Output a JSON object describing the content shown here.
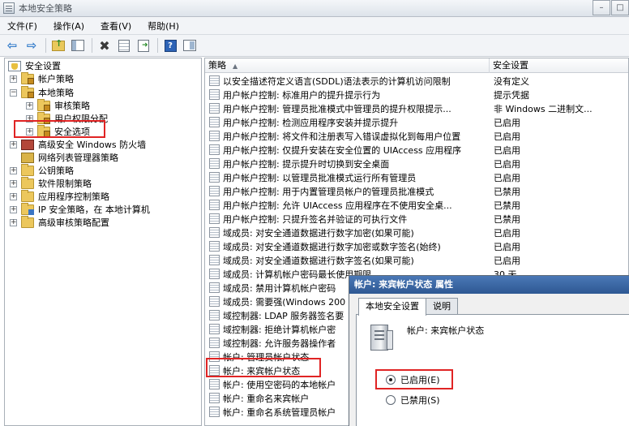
{
  "window": {
    "title": "本地安全策略",
    "controls": {
      "minimize": "–",
      "maximize": "□"
    }
  },
  "menubar": {
    "items": [
      "文件(F)",
      "操作(A)",
      "查看(V)",
      "帮助(H)"
    ]
  },
  "tree": {
    "root": "安全设置",
    "items": [
      {
        "label": "帐户策略",
        "level": 1,
        "expander": "+",
        "icon": "folder-lock"
      },
      {
        "label": "本地策略",
        "level": 1,
        "expander": "−",
        "icon": "folder-lock"
      },
      {
        "label": "审核策略",
        "level": 2,
        "expander": "+",
        "icon": "folder-lock"
      },
      {
        "label": "用户权限分配",
        "level": 2,
        "expander": "+",
        "icon": "folder-lock"
      },
      {
        "label": "安全选项",
        "level": 2,
        "expander": "+",
        "icon": "folder-lock",
        "selected": true
      },
      {
        "label": "高级安全 Windows 防火墙",
        "level": 1,
        "expander": "+",
        "icon": "firewall"
      },
      {
        "label": "网络列表管理器策略",
        "level": 1,
        "expander": "",
        "icon": "network-list"
      },
      {
        "label": "公钥策略",
        "level": 1,
        "expander": "+",
        "icon": "folder"
      },
      {
        "label": "软件限制策略",
        "level": 1,
        "expander": "+",
        "icon": "folder"
      },
      {
        "label": "应用程序控制策略",
        "level": 1,
        "expander": "+",
        "icon": "folder"
      },
      {
        "label": "IP 安全策略，在 本地计算机",
        "level": 1,
        "expander": "+",
        "icon": "ip-security"
      },
      {
        "label": "高级审核策略配置",
        "level": 1,
        "expander": "+",
        "icon": "folder"
      }
    ]
  },
  "list": {
    "columns": {
      "policy": "策略",
      "setting": "安全设置"
    },
    "rows": [
      {
        "policy": "以安全描述符定义语言(SDDL)语法表示的计算机访问限制",
        "setting": "没有定义"
      },
      {
        "policy": "用户帐户控制: 标准用户的提升提示行为",
        "setting": "提示凭据"
      },
      {
        "policy": "用户帐户控制: 管理员批准模式中管理员的提升权限提示...",
        "setting": "非 Windows 二进制文..."
      },
      {
        "policy": "用户帐户控制: 检测应用程序安装并提示提升",
        "setting": "已启用"
      },
      {
        "policy": "用户帐户控制: 将文件和注册表写入错误虚拟化到每用户位置",
        "setting": "已启用"
      },
      {
        "policy": "用户帐户控制: 仅提升安装在安全位置的 UIAccess 应用程序",
        "setting": "已启用"
      },
      {
        "policy": "用户帐户控制: 提示提升时切换到安全桌面",
        "setting": "已启用"
      },
      {
        "policy": "用户帐户控制: 以管理员批准模式运行所有管理员",
        "setting": "已启用"
      },
      {
        "policy": "用户帐户控制: 用于内置管理员帐户的管理员批准模式",
        "setting": "已禁用"
      },
      {
        "policy": "用户帐户控制: 允许 UIAccess 应用程序在不使用安全桌...",
        "setting": "已禁用"
      },
      {
        "policy": "用户帐户控制: 只提升签名并验证的可执行文件",
        "setting": "已禁用"
      },
      {
        "policy": "域成员: 对安全通道数据进行数字加密(如果可能)",
        "setting": "已启用"
      },
      {
        "policy": "域成员: 对安全通道数据进行数字加密或数字签名(始终)",
        "setting": "已启用"
      },
      {
        "policy": "域成员: 对安全通道数据进行数字签名(如果可能)",
        "setting": "已启用"
      },
      {
        "policy": "域成员: 计算机帐户密码最长使用期限",
        "setting": "30 天"
      },
      {
        "policy": "域成员: 禁用计算机帐户密码",
        "setting": ""
      },
      {
        "policy": "域成员: 需要强(Windows 200",
        "setting": ""
      },
      {
        "policy": "域控制器: LDAP 服务器签名要",
        "setting": ""
      },
      {
        "policy": "域控制器: 拒绝计算机帐户密",
        "setting": ""
      },
      {
        "policy": "域控制器: 允许服务器操作者",
        "setting": ""
      },
      {
        "policy": "帐户: 管理员帐户状态",
        "setting": ""
      },
      {
        "policy": "帐户: 来宾帐户状态",
        "setting": "",
        "highlighted": true
      },
      {
        "policy": "帐户: 使用空密码的本地帐户",
        "setting": ""
      },
      {
        "policy": "帐户: 重命名来宾帐户",
        "setting": ""
      },
      {
        "policy": "帐户: 重命名系统管理员帐户",
        "setting": ""
      }
    ]
  },
  "dialog": {
    "title": "帐户: 来宾帐户状态 属性",
    "tabs": [
      "本地安全设置",
      "说明"
    ],
    "policy_name": "帐户: 来宾帐户状态",
    "options": [
      {
        "label": "已启用(E)",
        "checked": true
      },
      {
        "label": "已禁用(S)",
        "checked": false
      }
    ]
  },
  "annotation_color": "#e02424"
}
